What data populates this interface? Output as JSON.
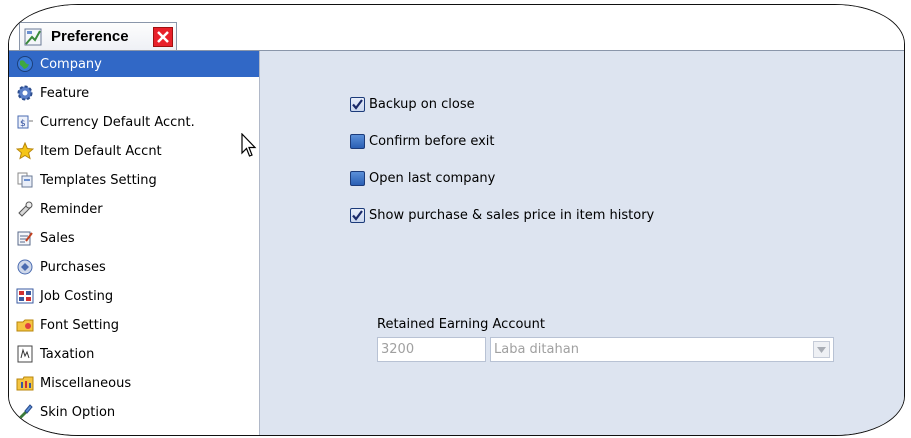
{
  "window": {
    "tab_title": "Preference",
    "tab_icon": "preference-icon",
    "close_icon": "close-icon"
  },
  "sidebar": {
    "items": [
      {
        "label": "Company",
        "icon": "globe-icon",
        "selected": true
      },
      {
        "label": "Feature",
        "icon": "gear-icon",
        "selected": false
      },
      {
        "label": "Currency Default Accnt.",
        "icon": "currency-icon",
        "selected": false
      },
      {
        "label": "Item Default Accnt",
        "icon": "star-icon",
        "selected": false
      },
      {
        "label": "Templates Setting",
        "icon": "templates-icon",
        "selected": false
      },
      {
        "label": "Reminder",
        "icon": "reminder-icon",
        "selected": false
      },
      {
        "label": "Sales",
        "icon": "sales-icon",
        "selected": false
      },
      {
        "label": "Purchases",
        "icon": "purchases-icon",
        "selected": false
      },
      {
        "label": "Job Costing",
        "icon": "job-costing-icon",
        "selected": false
      },
      {
        "label": "Font Setting",
        "icon": "font-icon",
        "selected": false
      },
      {
        "label": "Taxation",
        "icon": "taxation-icon",
        "selected": false
      },
      {
        "label": "Miscellaneous",
        "icon": "miscellaneous-icon",
        "selected": false
      },
      {
        "label": "Skin Option",
        "icon": "skin-icon",
        "selected": false
      }
    ]
  },
  "options": [
    {
      "label": "Backup on close",
      "checked": true
    },
    {
      "label": "Confirm before exit",
      "checked": false
    },
    {
      "label": "Open last company",
      "checked": false
    },
    {
      "label": "Show purchase & sales price in item history",
      "checked": true
    }
  ],
  "retained_earning": {
    "label": "Retained Earning Account",
    "code": "3200",
    "name": "Laba ditahan"
  },
  "colors": {
    "selected_bg": "#3168c6",
    "panel_bg": "#dde4f0",
    "close_red": "#e8202a"
  }
}
